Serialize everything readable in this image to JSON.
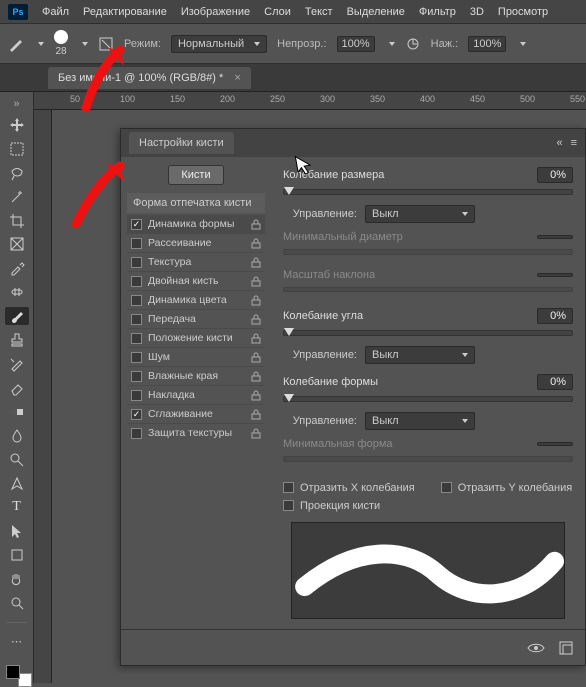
{
  "menu": {
    "items": [
      "Файл",
      "Редактирование",
      "Изображение",
      "Слои",
      "Текст",
      "Выделение",
      "Фильтр",
      "3D",
      "Просмотр"
    ],
    "logo": "Ps"
  },
  "options": {
    "brush_size": "28",
    "mode_label": "Режим:",
    "mode_value": "Нормальный",
    "opacity_label": "Непрозр.:",
    "opacity_value": "100%",
    "flow_label": "Наж.:",
    "flow_value": "100%"
  },
  "document": {
    "tab_title": "Без имени-1 @ 100% (RGB/8#) *"
  },
  "ruler": {
    "marks": [
      "50",
      "100",
      "150",
      "200",
      "250",
      "300",
      "350",
      "400",
      "450",
      "500",
      "550"
    ]
  },
  "panel": {
    "title": "Настройки кисти",
    "brushes_button": "Кисти",
    "shape_header": "Форма отпечатка кисти",
    "opts": [
      {
        "label": "Динамика формы",
        "checked": true,
        "selected": true
      },
      {
        "label": "Рассеивание",
        "checked": false
      },
      {
        "label": "Текстура",
        "checked": false
      },
      {
        "label": "Двойная кисть",
        "checked": false
      },
      {
        "label": "Динамика цвета",
        "checked": false
      },
      {
        "label": "Передача",
        "checked": false
      },
      {
        "label": "Положение кисти",
        "checked": false
      },
      {
        "label": "Шум",
        "checked": false
      },
      {
        "label": "Влажные края",
        "checked": false
      },
      {
        "label": "Накладка",
        "checked": false
      },
      {
        "label": "Сглаживание",
        "checked": true
      },
      {
        "label": "Защита текстуры",
        "checked": false
      }
    ],
    "right": {
      "size_jitter": "Колебание размера",
      "size_jitter_val": "0%",
      "control_label": "Управление:",
      "control_off": "Выкл",
      "min_diam": "Минимальный диаметр",
      "tilt_scale": "Масштаб наклона",
      "angle_jitter": "Колебание угла",
      "angle_jitter_val": "0%",
      "round_jitter": "Колебание формы",
      "round_jitter_val": "0%",
      "min_round": "Минимальная форма",
      "flip_x": "Отразить X колебания",
      "flip_y": "Отразить Y колебания",
      "projection": "Проекция кисти"
    }
  }
}
